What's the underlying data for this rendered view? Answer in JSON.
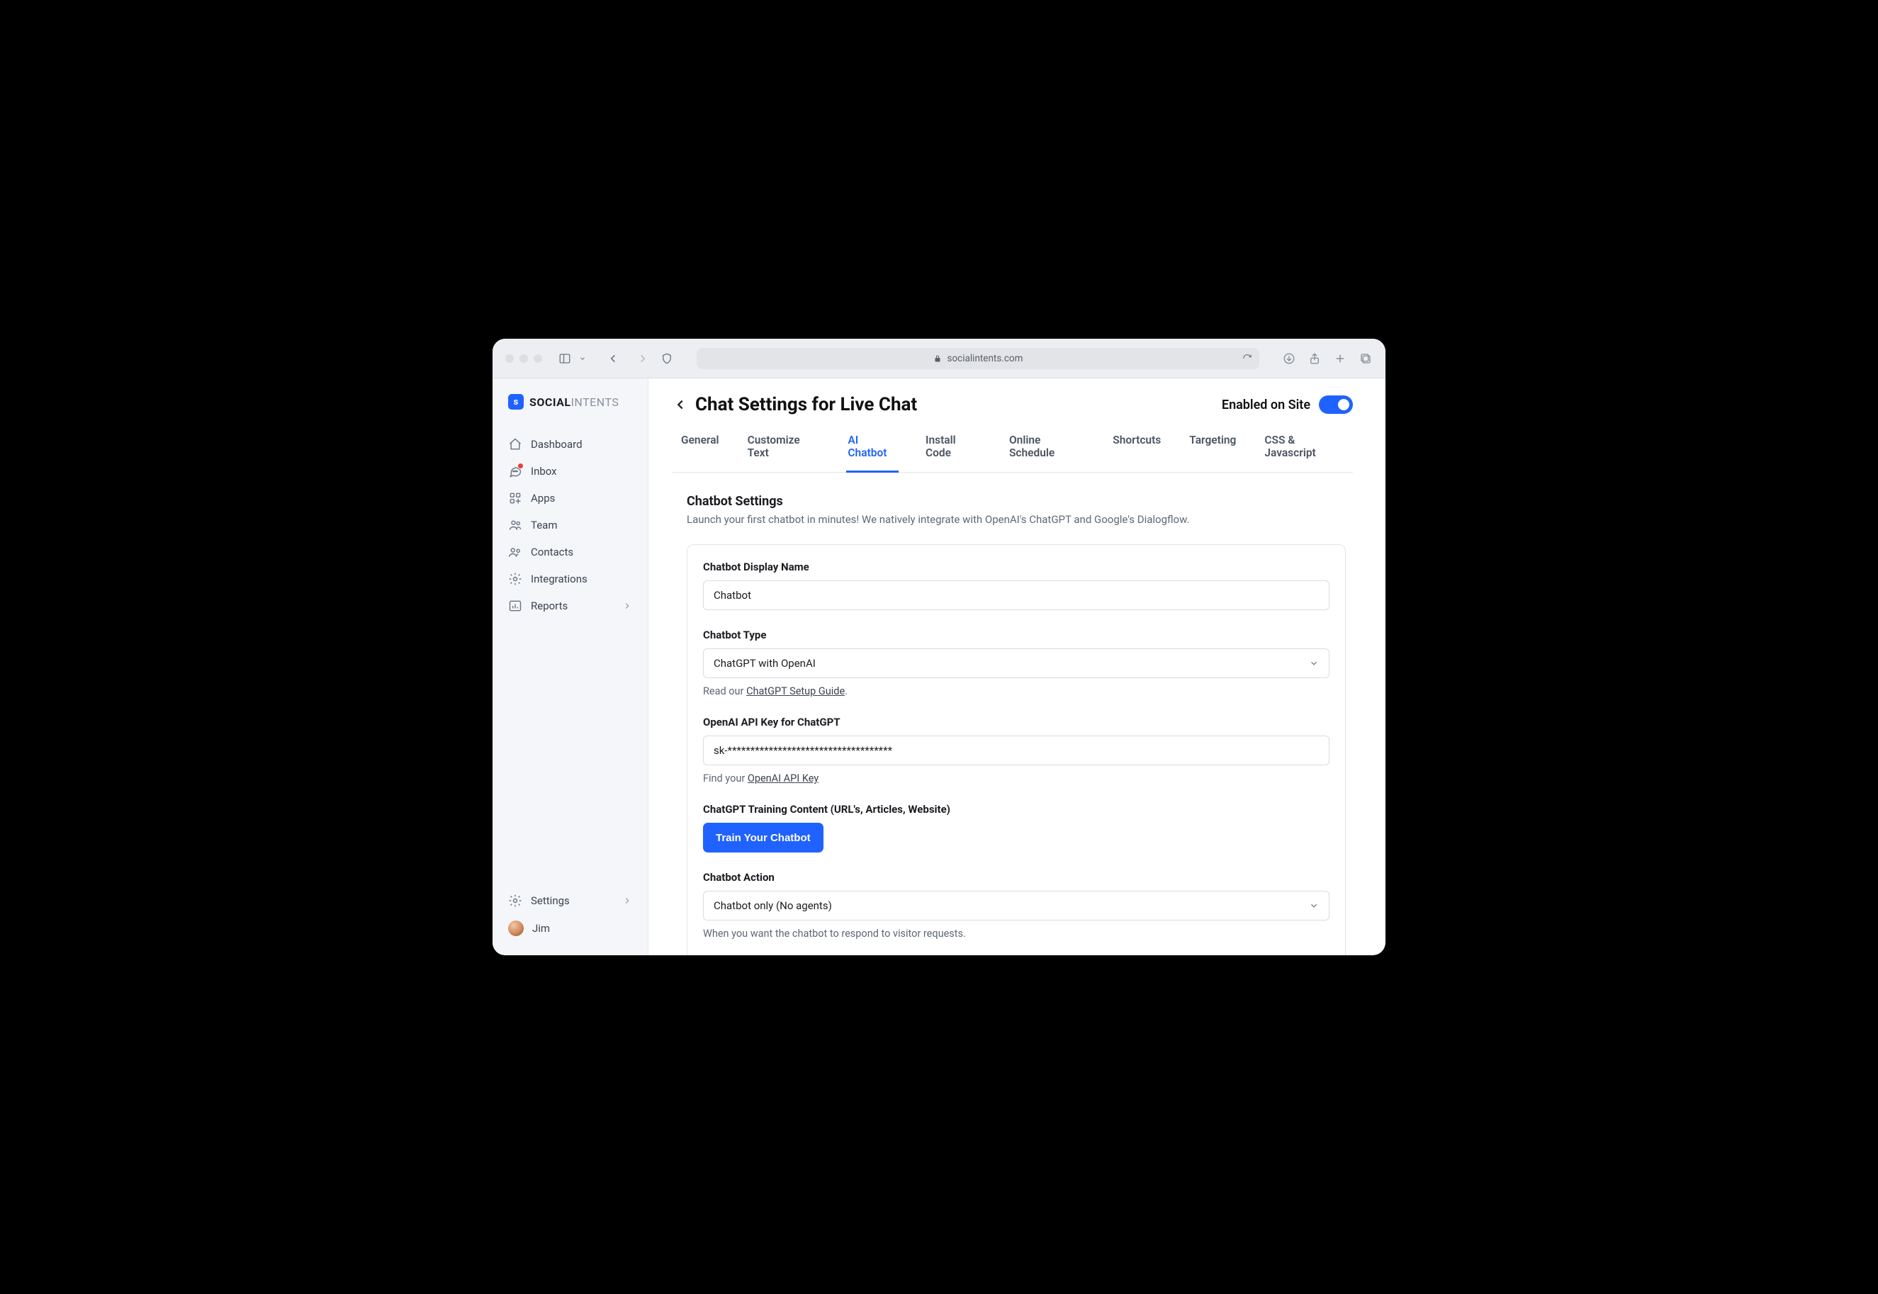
{
  "browser": {
    "host": "socialintents.com"
  },
  "brand": {
    "mark": "s",
    "bold": "SOCIAL",
    "light": "INTENTS"
  },
  "sidebar": {
    "items": [
      {
        "label": "Dashboard"
      },
      {
        "label": "Inbox"
      },
      {
        "label": "Apps"
      },
      {
        "label": "Team"
      },
      {
        "label": "Contacts"
      },
      {
        "label": "Integrations"
      },
      {
        "label": "Reports"
      }
    ],
    "footer": {
      "settings": "Settings",
      "user": "Jim"
    }
  },
  "header": {
    "title": "Chat Settings for Live Chat",
    "enable_label": "Enabled on Site"
  },
  "tabs": [
    "General",
    "Customize Text",
    "AI Chatbot",
    "Install Code",
    "Online Schedule",
    "Shortcuts",
    "Targeting",
    "CSS & Javascript"
  ],
  "active_tab_index": 2,
  "section": {
    "title": "Chatbot Settings",
    "desc": "Launch your first chatbot in minutes! We natively integrate with OpenAI's ChatGPT and Google's Dialogflow."
  },
  "form": {
    "display_name": {
      "label": "Chatbot Display Name",
      "value": "Chatbot"
    },
    "chatbot_type": {
      "label": "Chatbot Type",
      "value": "ChatGPT with OpenAI",
      "helper_prefix": "Read our ",
      "helper_link": "ChatGPT Setup Guide",
      "helper_suffix": "."
    },
    "api_key": {
      "label": "OpenAI API Key for ChatGPT",
      "value": "sk-************************************",
      "helper_prefix": "Find your ",
      "helper_link": "OpenAI API Key"
    },
    "training": {
      "label": "ChatGPT Training Content (URL's, Articles, Website)",
      "button": "Train Your Chatbot"
    },
    "action": {
      "label": "Chatbot Action",
      "value": "Chatbot only (No agents)",
      "helper": "When you want the chatbot to respond to visitor requests."
    }
  }
}
